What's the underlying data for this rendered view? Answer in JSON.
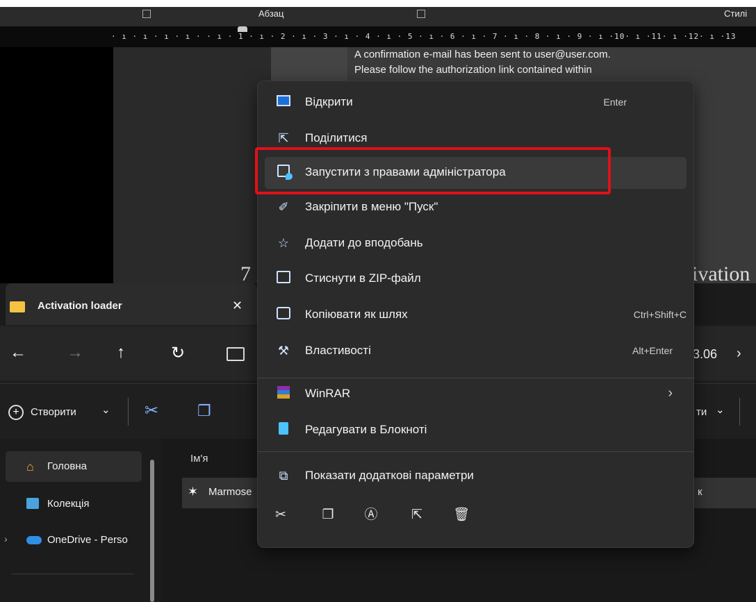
{
  "ribbon": {
    "paragraph_label": "Абзац",
    "styles_label": "Стилі",
    "ruler_text": "· ı · ı · ı · ı ·  · ı · 1 · ı · 2 · ı · 3 · ı · 4 · ı · 5 · ı · 6 · ı · 7 · ı · 8 · ı · 9 · ı ·10· ı ·11· ı ·12· ı ·13"
  },
  "document": {
    "confirmation_line1": "A confirmation e-mail has been sent to user@user.com.",
    "confirmation_line2": "Please follow the authorization link contained within",
    "fragment_left": "7",
    "fragment_right": "ivation"
  },
  "explorer": {
    "tab_title": "Activation loader",
    "close_glyph": "✕",
    "nav": {
      "back": "←",
      "forward": "→",
      "up": "↑",
      "refresh": "↻",
      "path_fragment": "3.06",
      "path_chevron": "›"
    },
    "cmd": {
      "create_label": "Створити",
      "create_chevron": "⌄",
      "sort_fragment": "ти",
      "sort_chevron": "⌄"
    },
    "sidebar": [
      {
        "label": "Головна",
        "icon": "home-icon"
      },
      {
        "label": "Колекція",
        "icon": "gallery-icon"
      },
      {
        "label": "OneDrive - Perso",
        "icon": "cloud-icon"
      }
    ],
    "column_name": "Ім'я",
    "file_name": "Marmose",
    "file_type_fragment": "к"
  },
  "context_menu": {
    "items": [
      {
        "label": "Відкрити",
        "shortcut": "Enter",
        "icon": "open-icon"
      },
      {
        "label": "Поділитися",
        "shortcut": "",
        "icon": "share-icon"
      },
      {
        "label": "Запустити з правами адміністратора",
        "shortcut": "",
        "icon": "admin-shield-icon"
      },
      {
        "label": "Закріпити в меню \"Пуск\"",
        "shortcut": "",
        "icon": "pin-icon"
      },
      {
        "label": "Додати до вподобань",
        "shortcut": "",
        "icon": "star-icon"
      },
      {
        "label": "Стиснути в ZIP-файл",
        "shortcut": "",
        "icon": "zip-icon"
      },
      {
        "label": "Копіювати як шлях",
        "shortcut": "Ctrl+Shift+C",
        "icon": "copy-path-icon"
      },
      {
        "label": "Властивості",
        "shortcut": "Alt+Enter",
        "icon": "wrench-icon"
      },
      {
        "label": "WinRAR",
        "shortcut": "›",
        "icon": "winrar-icon"
      },
      {
        "label": "Редагувати в Блокноті",
        "shortcut": "",
        "icon": "notepad-icon"
      },
      {
        "label": "Показати додаткові параметри",
        "shortcut": "",
        "icon": "more-options-icon"
      }
    ],
    "quick_actions": [
      "cut-icon",
      "copy-icon",
      "rename-icon",
      "share-icon",
      "delete-icon"
    ]
  },
  "colors": {
    "highlight_border": "#e0101a",
    "menu_bg": "#2b2b2b",
    "accent": "#4cc2ff"
  }
}
